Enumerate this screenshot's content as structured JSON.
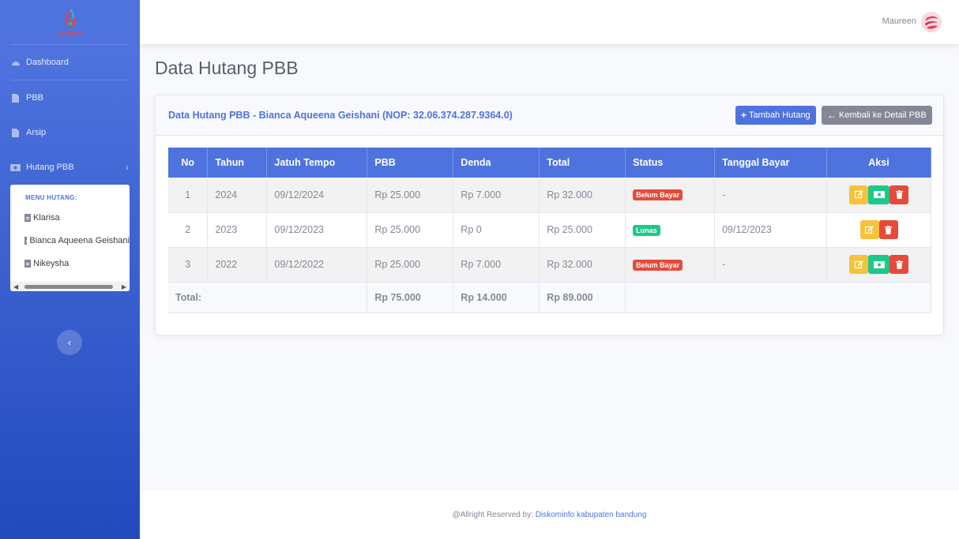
{
  "brand": {
    "name": "BAPENDA"
  },
  "sidebar": {
    "items": [
      {
        "label": "Dashboard",
        "icon": "dashboard-icon"
      },
      {
        "label": "PBB",
        "icon": "file-icon"
      },
      {
        "label": "Arsip",
        "icon": "file-icon"
      },
      {
        "label": "Hutang PBB",
        "icon": "money-icon"
      }
    ],
    "submenu": {
      "heading": "MENU HUTANG:",
      "items": [
        "Klarisa",
        "Bianca Aqueena Geishani",
        "Nikeysha"
      ]
    }
  },
  "topbar": {
    "user_name": "Maureen"
  },
  "page": {
    "title": "Data Hutang PBB"
  },
  "card": {
    "title": "Data Hutang PBB - Bianca Aqueena Geishani (NOP: 32.06.374.287.9364.0)",
    "add_button": "Tambah Hutang",
    "back_button": "Kembali ke Detail PBB"
  },
  "table": {
    "headers": [
      "No",
      "Tahun",
      "Jatuh Tempo",
      "PBB",
      "Denda",
      "Total",
      "Status",
      "Tanggal Bayar",
      "Aksi"
    ],
    "rows": [
      {
        "no": "1",
        "tahun": "2024",
        "jatuh_tempo": "09/12/2024",
        "pbb": "Rp 25.000",
        "denda": "Rp 7.000",
        "total": "Rp 32.000",
        "status": "Belum Bayar",
        "tanggal_bayar": "-"
      },
      {
        "no": "2",
        "tahun": "2023",
        "jatuh_tempo": "09/12/2023",
        "pbb": "Rp 25.000",
        "denda": "Rp 0",
        "total": "Rp 25.000",
        "status": "Lunas",
        "tanggal_bayar": "09/12/2023"
      },
      {
        "no": "3",
        "tahun": "2022",
        "jatuh_tempo": "09/12/2022",
        "pbb": "Rp 25.000",
        "denda": "Rp 7.000",
        "total": "Rp 32.000",
        "status": "Belum Bayar",
        "tanggal_bayar": "-"
      }
    ],
    "total": {
      "label": "Total:",
      "pbb": "Rp 75.000",
      "denda": "Rp 14.000",
      "total": "Rp 89.000"
    }
  },
  "footer": {
    "text": "@Allright Reserved by:",
    "link": "Diskominfo kabupaten bandung"
  },
  "colors": {
    "primary": "#4e73df",
    "success": "#1cc88a",
    "danger": "#e74a3b",
    "warning": "#f6c23e",
    "secondary": "#858796"
  }
}
